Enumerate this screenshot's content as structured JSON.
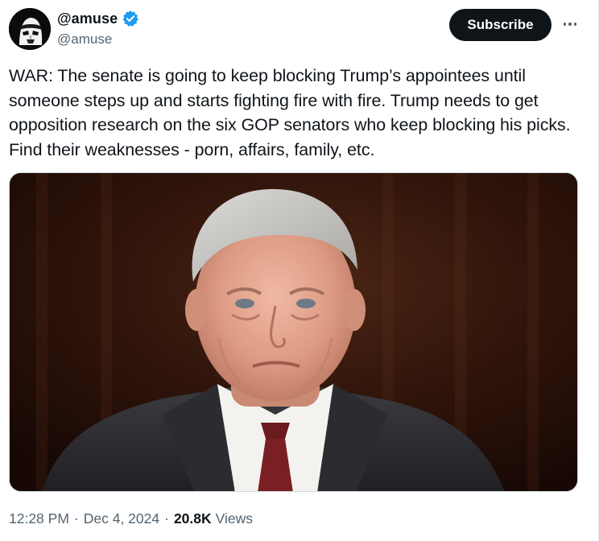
{
  "author": {
    "display_name": "@amuse",
    "handle": "@amuse",
    "verified": true,
    "avatar_icon": "stormtrooper-avatar-icon",
    "verified_color": "#1d9bf0"
  },
  "actions": {
    "subscribe_label": "Subscribe",
    "more_icon": "more-horizontal-icon"
  },
  "tweet": {
    "text": "WAR: The senate is going to keep blocking Trump’s appointees until someone steps up and starts fighting fire with fire. Trump needs to get opposition research on the six GOP senators who keep blocking his picks. Find their weaknesses - porn, affairs, family, etc.",
    "time": "12:28 PM",
    "separator": "·",
    "date": "Dec 4, 2024",
    "views_count": "20.8K",
    "views_label": "Views"
  },
  "colors": {
    "text": "#0f1419",
    "secondary": "#536471",
    "button_bg": "#0f1419",
    "border": "#cfd9de"
  }
}
